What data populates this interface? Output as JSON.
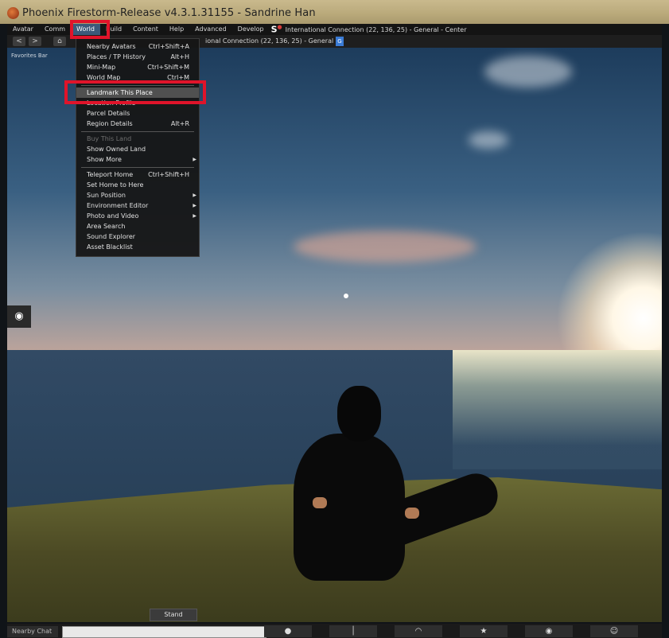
{
  "window": {
    "title": "Phoenix Firestorm-Release v4.3.1.31155 - Sandrine Han"
  },
  "menubar": {
    "items": [
      "Avatar",
      "Comm",
      "World",
      "Build",
      "Content",
      "Help",
      "Advanced",
      "Develop"
    ],
    "s_icon": "S",
    "connection": "International Connection (22, 136, 25) - General - Center"
  },
  "navbar": {
    "back_icon": "<",
    "forward_icon": ">",
    "home_icon": "⌂",
    "location": "ional Connection (22, 136, 25) - General",
    "maturity_badge": "G"
  },
  "favorites_bar": "Favorites Bar",
  "world_menu": {
    "items": [
      {
        "label": "Nearby Avatars",
        "shortcut": "Ctrl+Shift+A"
      },
      {
        "label": "Places / TP History",
        "shortcut": "Alt+H"
      },
      {
        "label": "Mini-Map",
        "shortcut": "Ctrl+Shift+M"
      },
      {
        "label": "World Map",
        "shortcut": "Ctrl+M"
      },
      {
        "label": "Landmark This Place",
        "shortcut": ""
      },
      {
        "label": "Location Profile",
        "shortcut": ""
      },
      {
        "label": "Parcel Details",
        "shortcut": ""
      },
      {
        "label": "Region Details",
        "shortcut": "Alt+R"
      },
      {
        "label": "Buy This Land",
        "shortcut": ""
      },
      {
        "label": "Show Owned Land",
        "shortcut": ""
      },
      {
        "label": "Show More",
        "shortcut": ""
      },
      {
        "label": "Teleport Home",
        "shortcut": "Ctrl+Shift+H"
      },
      {
        "label": "Set Home to Here",
        "shortcut": ""
      },
      {
        "label": "Sun Position",
        "shortcut": ""
      },
      {
        "label": "Environment Editor",
        "shortcut": ""
      },
      {
        "label": "Photo and Video",
        "shortcut": ""
      },
      {
        "label": "Area Search",
        "shortcut": ""
      },
      {
        "label": "Sound Explorer",
        "shortcut": ""
      },
      {
        "label": "Asset Blacklist",
        "shortcut": ""
      }
    ]
  },
  "map_pin_icon": "◉",
  "stand_button": "Stand",
  "chat": {
    "label": "Nearby Chat",
    "input_value": ""
  },
  "toolbar_icons": [
    "chat-icon",
    "microphone-icon",
    "headset-icon",
    "walk-icon",
    "eye-icon",
    "people-icon"
  ],
  "toolbar_glyphs": [
    "●",
    "│",
    "◠",
    "★",
    "◉",
    "☺"
  ],
  "colors": {
    "highlight_box": "#e0142a",
    "menu_highlight": "#505050"
  }
}
